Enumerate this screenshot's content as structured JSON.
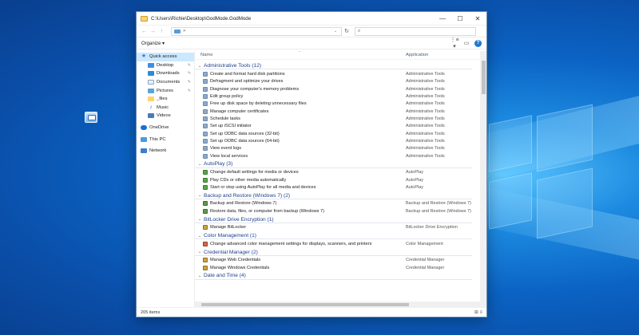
{
  "window": {
    "title": "C:\\Users\\Richie\\Desktop\\GodMode.GodMode",
    "minimize": "—",
    "maximize": "☐",
    "close": "✕"
  },
  "address": {
    "back": "←",
    "forward": "→",
    "up": "↑",
    "path": "»",
    "dropdown": "⌄",
    "refresh": "↻",
    "search_placeholder": "⌕"
  },
  "toolbar": {
    "organize": "Organize ▾",
    "view_menu": "⋮≡ ▾",
    "preview_pane": "▭",
    "help": "?"
  },
  "navpane": {
    "items": [
      {
        "label": "Quick access",
        "icon": "star-icon"
      },
      {
        "label": "Desktop",
        "icon": "desktop-icon"
      },
      {
        "label": "Downloads",
        "icon": "downloads-icon"
      },
      {
        "label": "Documents",
        "icon": "documents-icon"
      },
      {
        "label": "Pictures",
        "icon": "pictures-icon"
      },
      {
        "label": "_files",
        "icon": "folder-icon"
      },
      {
        "label": "Music",
        "icon": "music-icon"
      },
      {
        "label": "Videos",
        "icon": "videos-icon"
      },
      {
        "label": "OneDrive",
        "icon": "onedrive-icon"
      },
      {
        "label": "This PC",
        "icon": "this-pc-icon"
      },
      {
        "label": "Network",
        "icon": "network-icon"
      }
    ]
  },
  "columns": {
    "name": "Name",
    "application": "Application"
  },
  "groups": [
    {
      "label": "Administrative Tools (12)",
      "items": [
        {
          "name": "Create and format hard disk partitions",
          "app": "Administrative Tools"
        },
        {
          "name": "Defragment and optimize your drives",
          "app": "Administrative Tools"
        },
        {
          "name": "Diagnose your computer's memory problems",
          "app": "Administrative Tools"
        },
        {
          "name": "Edit group policy",
          "app": "Administrative Tools"
        },
        {
          "name": "Free up disk space by deleting unnecessary files",
          "app": "Administrative Tools"
        },
        {
          "name": "Manage computer certificates",
          "app": "Administrative Tools"
        },
        {
          "name": "Schedule tasks",
          "app": "Administrative Tools"
        },
        {
          "name": "Set up iSCSI initiator",
          "app": "Administrative Tools"
        },
        {
          "name": "Set up ODBC data sources (32-bit)",
          "app": "Administrative Tools"
        },
        {
          "name": "Set up ODBC data sources (64-bit)",
          "app": "Administrative Tools"
        },
        {
          "name": "View event logs",
          "app": "Administrative Tools"
        },
        {
          "name": "View local services",
          "app": "Administrative Tools"
        }
      ]
    },
    {
      "label": "AutoPlay (3)",
      "items": [
        {
          "name": "Change default settings for media or devices",
          "app": "AutoPlay"
        },
        {
          "name": "Play CDs or other media automatically",
          "app": "AutoPlay"
        },
        {
          "name": "Start or stop using AutoPlay for all media and devices",
          "app": "AutoPlay"
        }
      ]
    },
    {
      "label": "Backup and Restore (Windows 7) (2)",
      "items": [
        {
          "name": "Backup and Restore (Windows 7)",
          "app": "Backup and Restore (Windows 7)"
        },
        {
          "name": "Restore data, files, or computer from backup (Windows 7)",
          "app": "Backup and Restore (Windows 7)"
        }
      ]
    },
    {
      "label": "BitLocker Drive Encryption (1)",
      "items": [
        {
          "name": "Manage BitLocker",
          "app": "BitLocker Drive Encryption"
        }
      ]
    },
    {
      "label": "Color Management (1)",
      "items": [
        {
          "name": "Change advanced color management settings for displays, scanners, and printers",
          "app": "Color Management"
        }
      ]
    },
    {
      "label": "Credential Manager (2)",
      "items": [
        {
          "name": "Manage Web Credentials",
          "app": "Credential Manager"
        },
        {
          "name": "Manage Windows Credentials",
          "app": "Credential Manager"
        }
      ]
    },
    {
      "label": "Date and Time (4)",
      "items": []
    }
  ],
  "status": {
    "count": "205 items",
    "views": "⊞ ≡"
  }
}
